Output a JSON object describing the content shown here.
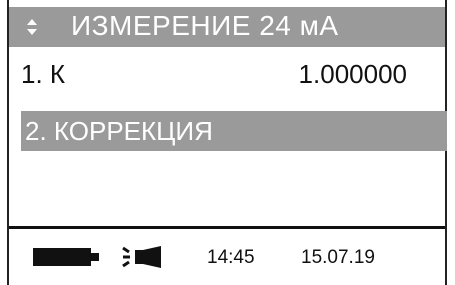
{
  "header": {
    "title": "ИЗМЕРЕНИЕ 24 мА",
    "nav_icon": "up-down-arrows-icon"
  },
  "menu": {
    "items": [
      {
        "label": "1. К",
        "value": "1.000000",
        "selected": false
      },
      {
        "label": "2. КОРРЕКЦИЯ",
        "value": "",
        "selected": true
      }
    ]
  },
  "status_bar": {
    "battery_icon": "battery-icon",
    "sensor_icon": "sensor-signal-icon",
    "time": "14:45",
    "date": "15.07.19"
  },
  "colors": {
    "highlight": "#9a9a9a",
    "text": "#111111",
    "background": "#ffffff"
  }
}
